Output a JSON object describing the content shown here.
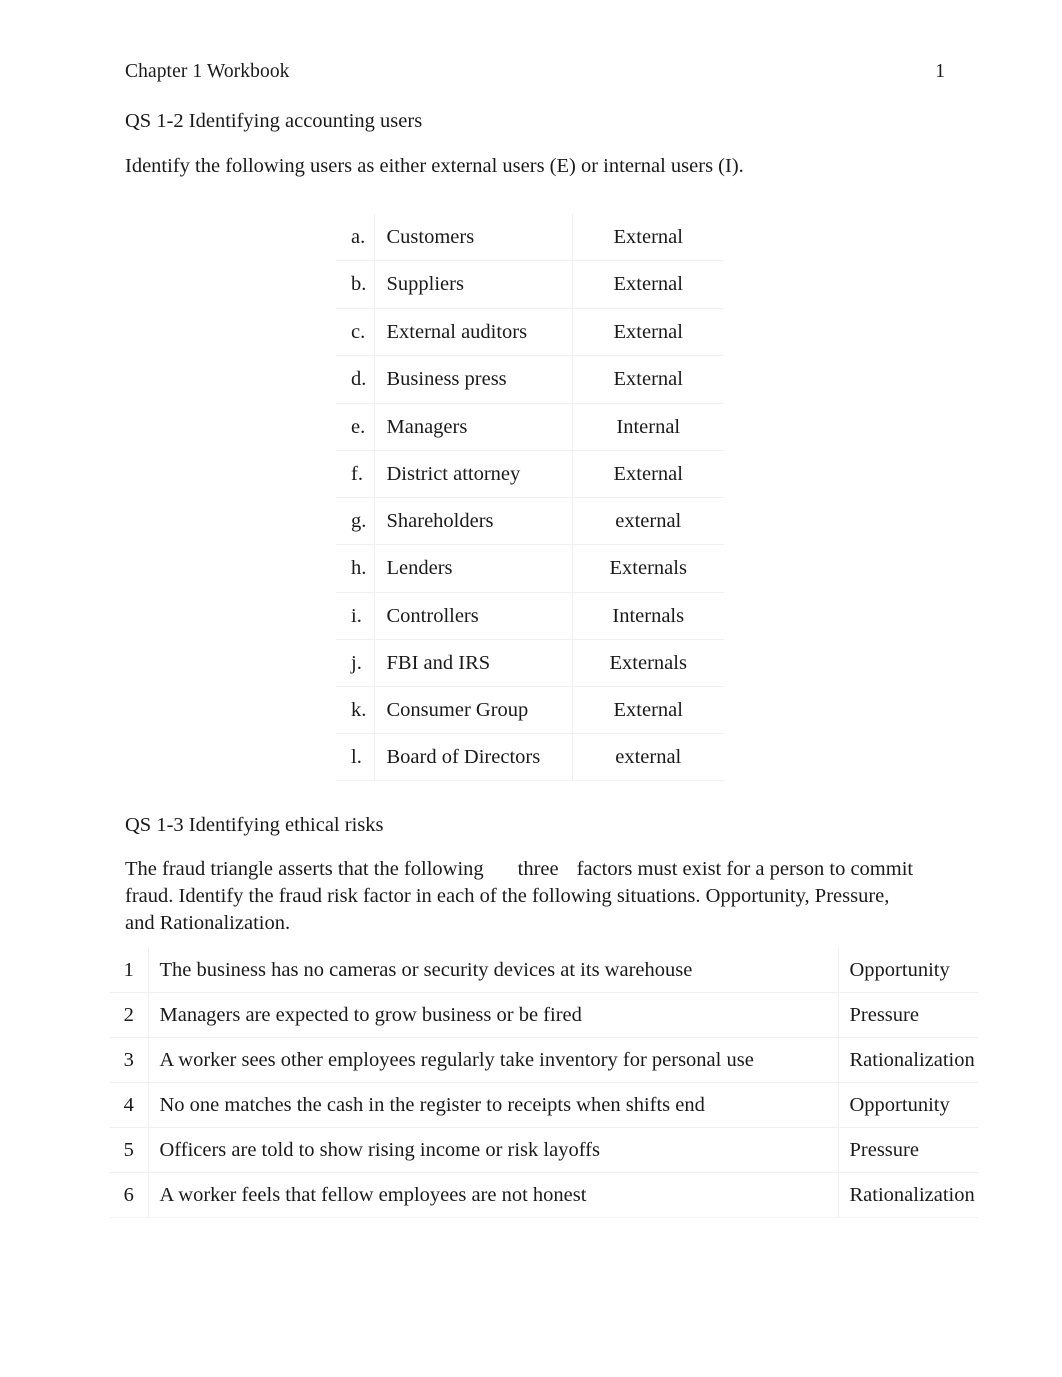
{
  "header": {
    "doc_title": "Chapter 1 Workbook",
    "page_number": "1"
  },
  "qs12": {
    "heading": "QS 1-2 Identifying accounting users",
    "instruction": "Identify the following users as either external users (E) or internal users (I).",
    "table": {
      "header_cells": [
        "",
        "",
        ""
      ],
      "rows": [
        {
          "letter": "a.",
          "user": "Customers",
          "answer": "External"
        },
        {
          "letter": "b.",
          "user": "Suppliers",
          "answer": "External"
        },
        {
          "letter": "c.",
          "user": "External auditors",
          "answer": "External"
        },
        {
          "letter": "d.",
          "user": "Business press",
          "answer": "External"
        },
        {
          "letter": "e.",
          "user": "Managers",
          "answer": "Internal"
        },
        {
          "letter": "f.",
          "user": "District attorney",
          "answer": "External"
        },
        {
          "letter": "g.",
          "user": "Shareholders",
          "answer": "external"
        },
        {
          "letter": "h.",
          "user": "Lenders",
          "answer": "Externals"
        },
        {
          "letter": "i.",
          "user": "Controllers",
          "answer": "Internals"
        },
        {
          "letter": "j.",
          "user": "FBI and IRS",
          "answer": "Externals"
        },
        {
          "letter": "k.",
          "user": "Consumer Group",
          "answer": "External"
        },
        {
          "letter": "l.",
          "user": "Board of Directors",
          "answer": "external"
        }
      ]
    }
  },
  "qs13": {
    "heading": "QS 1-3 Identifying ethical risks",
    "instruction_part1": "The fraud triangle asserts that the following",
    "instruction_blank": "three",
    "instruction_part2": "factors must exist for a person to commit fraud. Identify the fraud risk factor in each of the following situations. Opportunity, Pressure, and Rationalization.",
    "table": {
      "header_cells": [
        "",
        "",
        ""
      ],
      "rows": [
        {
          "num": "1",
          "situation": "The business has no cameras or security devices at its warehouse",
          "factor": "Opportunity"
        },
        {
          "num": "2",
          "situation": "Managers are expected to grow business or be fired",
          "factor": "Pressure"
        },
        {
          "num": "3",
          "situation": "A worker sees other employees regularly take inventory for personal use",
          "factor": "Rationalization"
        },
        {
          "num": "4",
          "situation": "No one matches the cash in the register to receipts when shifts end",
          "factor": "Opportunity"
        },
        {
          "num": "5",
          "situation": "Officers are told to show rising income or risk layoffs",
          "factor": "Pressure"
        },
        {
          "num": "6",
          "situation": "A worker feels that fellow employees are not honest",
          "factor": "Rationalization"
        }
      ]
    }
  },
  "colors": {
    "table_header_band": "#dce5ec",
    "row_divider": "#f0f0f0",
    "text": "#1a1a1a",
    "page_background": "#ffffff"
  }
}
